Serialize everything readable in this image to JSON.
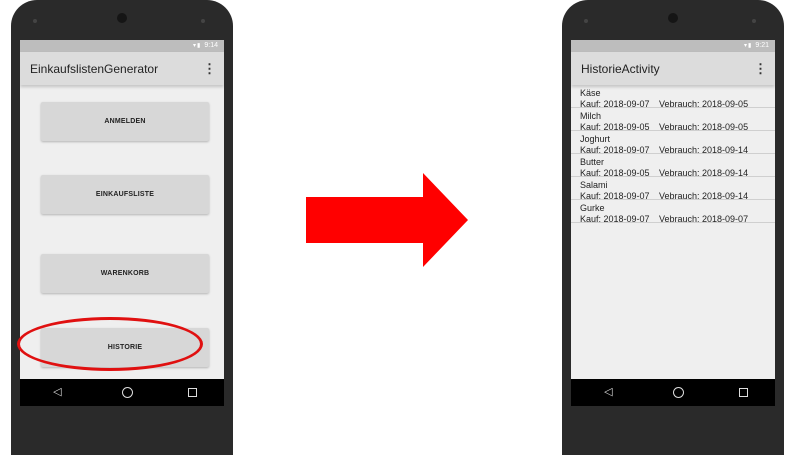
{
  "arrow_color": "#ff0000",
  "highlight_color": "#e01010",
  "left_phone": {
    "status": {
      "icons": "signal-icon battery-icon",
      "time": "9:14"
    },
    "app_title": "EinkaufslistenGenerator",
    "overflow_icon": "⋮",
    "buttons": [
      "ANMELDEN",
      "EINKAUFSLISTE",
      "WARENKORB",
      "HISTORIE"
    ],
    "nav": {
      "back": "◁",
      "home": "",
      "recent": ""
    }
  },
  "right_phone": {
    "status": {
      "icons": "signal-icon battery-icon",
      "time": "9:21"
    },
    "app_title": "HistorieActivity",
    "overflow_icon": "⋮",
    "items": [
      {
        "name": "Käse",
        "kauf": "Kauf: 2018-09-07",
        "verbrauch": "Vebrauch:  2018-09-05"
      },
      {
        "name": "Milch",
        "kauf": "Kauf: 2018-09-05",
        "verbrauch": "Vebrauch:  2018-09-05"
      },
      {
        "name": "Joghurt",
        "kauf": "Kauf: 2018-09-07",
        "verbrauch": "Vebrauch:  2018-09-14"
      },
      {
        "name": "Butter",
        "kauf": "Kauf: 2018-09-05",
        "verbrauch": "Vebrauch:  2018-09-14"
      },
      {
        "name": "Salami",
        "kauf": "Kauf: 2018-09-07",
        "verbrauch": "Vebrauch:  2018-09-14"
      },
      {
        "name": "Gurke",
        "kauf": "Kauf: 2018-09-07",
        "verbrauch": "Vebrauch:  2018-09-07"
      }
    ],
    "nav": {
      "back": "◁",
      "home": "",
      "recent": ""
    }
  }
}
